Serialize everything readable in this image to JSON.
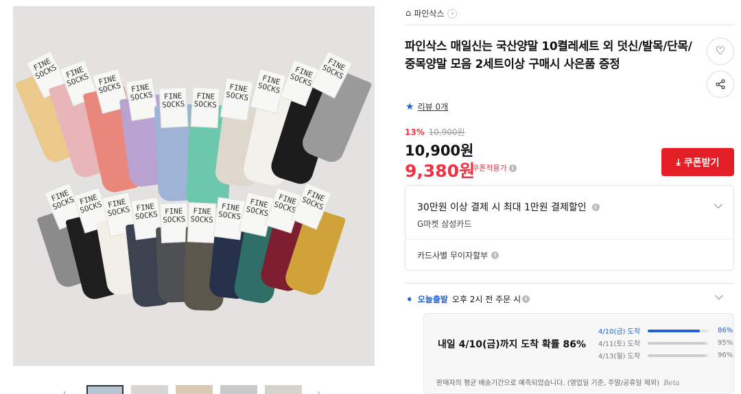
{
  "breadcrumb": {
    "store": "파인삭스"
  },
  "product": {
    "title": "파인삭스 매일신는 국산양말 10켤레세트 외 덧신/발목/단목/중목양말 모음 2세트이상 구매시 사은품 증정",
    "review_label": "리뷰 0개"
  },
  "price": {
    "discount_rate": "13%",
    "original": "10,900원",
    "sale": "10,900원",
    "coupon_price": "9,380원",
    "coupon_label": "쿠폰적용가"
  },
  "coupon_button": {
    "label": "쿠폰받기"
  },
  "benefit": {
    "title": "30만원 이상 결제 시 최대 1만원 결제할인",
    "subtitle": "G마켓 삼성카드",
    "installment": "카드사별 무이자할부"
  },
  "delivery": {
    "today_label": "오늘출발",
    "condition": "오후 2시 전 주문 시",
    "summary": "내일 4/10(금)까지 도착 확률 86%",
    "rows": [
      {
        "date": "4/10(금) 도착",
        "percent": "86%",
        "value": 0.86
      },
      {
        "date": "4/11(토) 도착",
        "percent": "95%",
        "value": 0.95
      },
      {
        "date": "4/13(월) 도착",
        "percent": "96%",
        "value": 0.96
      }
    ],
    "note": "판매자의 평균 배송기간으로 예측되었습니다. (영업일 기준, 주말/공휴일 제외)",
    "beta": "Beta"
  },
  "gallery": {
    "tag_text": "FINE SOCKS"
  },
  "colors": {
    "accent_red": "#e31e26",
    "accent_blue": "#1d5fd6"
  }
}
